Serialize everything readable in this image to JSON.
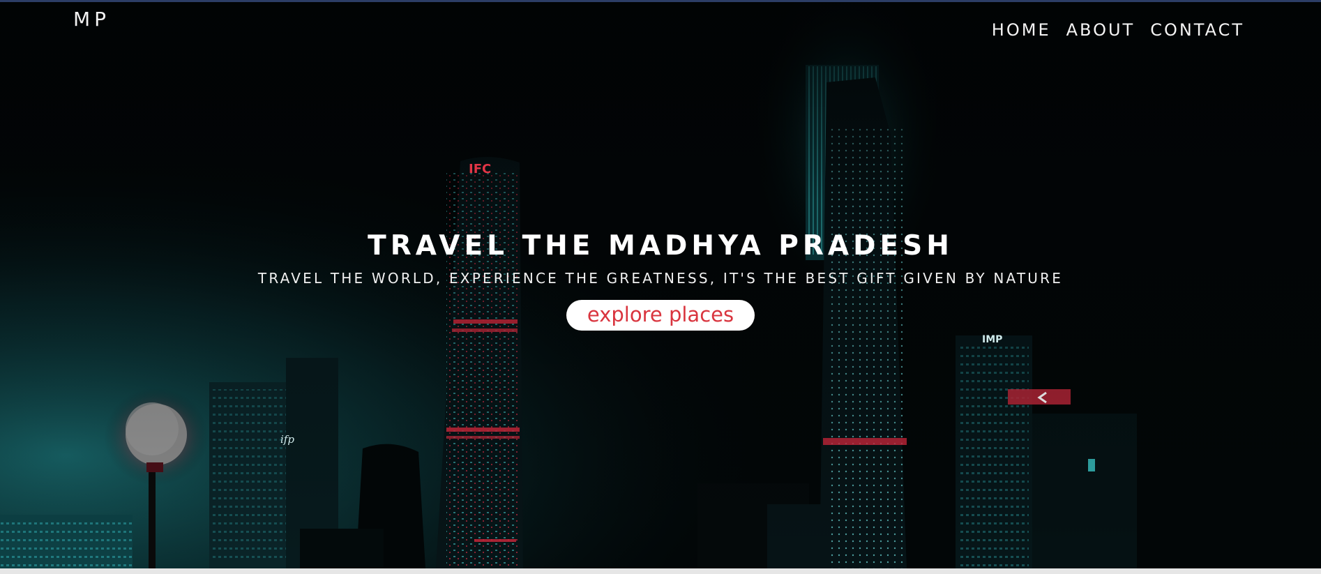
{
  "header": {
    "logo": "MP",
    "nav": [
      {
        "label": "HOME"
      },
      {
        "label": "ABOUT"
      },
      {
        "label": "CONTACT"
      }
    ]
  },
  "hero": {
    "title": "TRAVEL THE MADHYA PRADESH",
    "subtitle": "TRAVEL THE WORLD, EXPERIENCE THE GREATNESS, IT'S THE BEST GIFT GIVEN BY NATURE",
    "cta_label": "explore places"
  },
  "signs": {
    "ifc": "IFC",
    "imp": "IMP",
    "ifp": "ifp"
  },
  "colors": {
    "accent": "#d9343e",
    "teal": "#1fb3b3",
    "background": "#020607"
  }
}
